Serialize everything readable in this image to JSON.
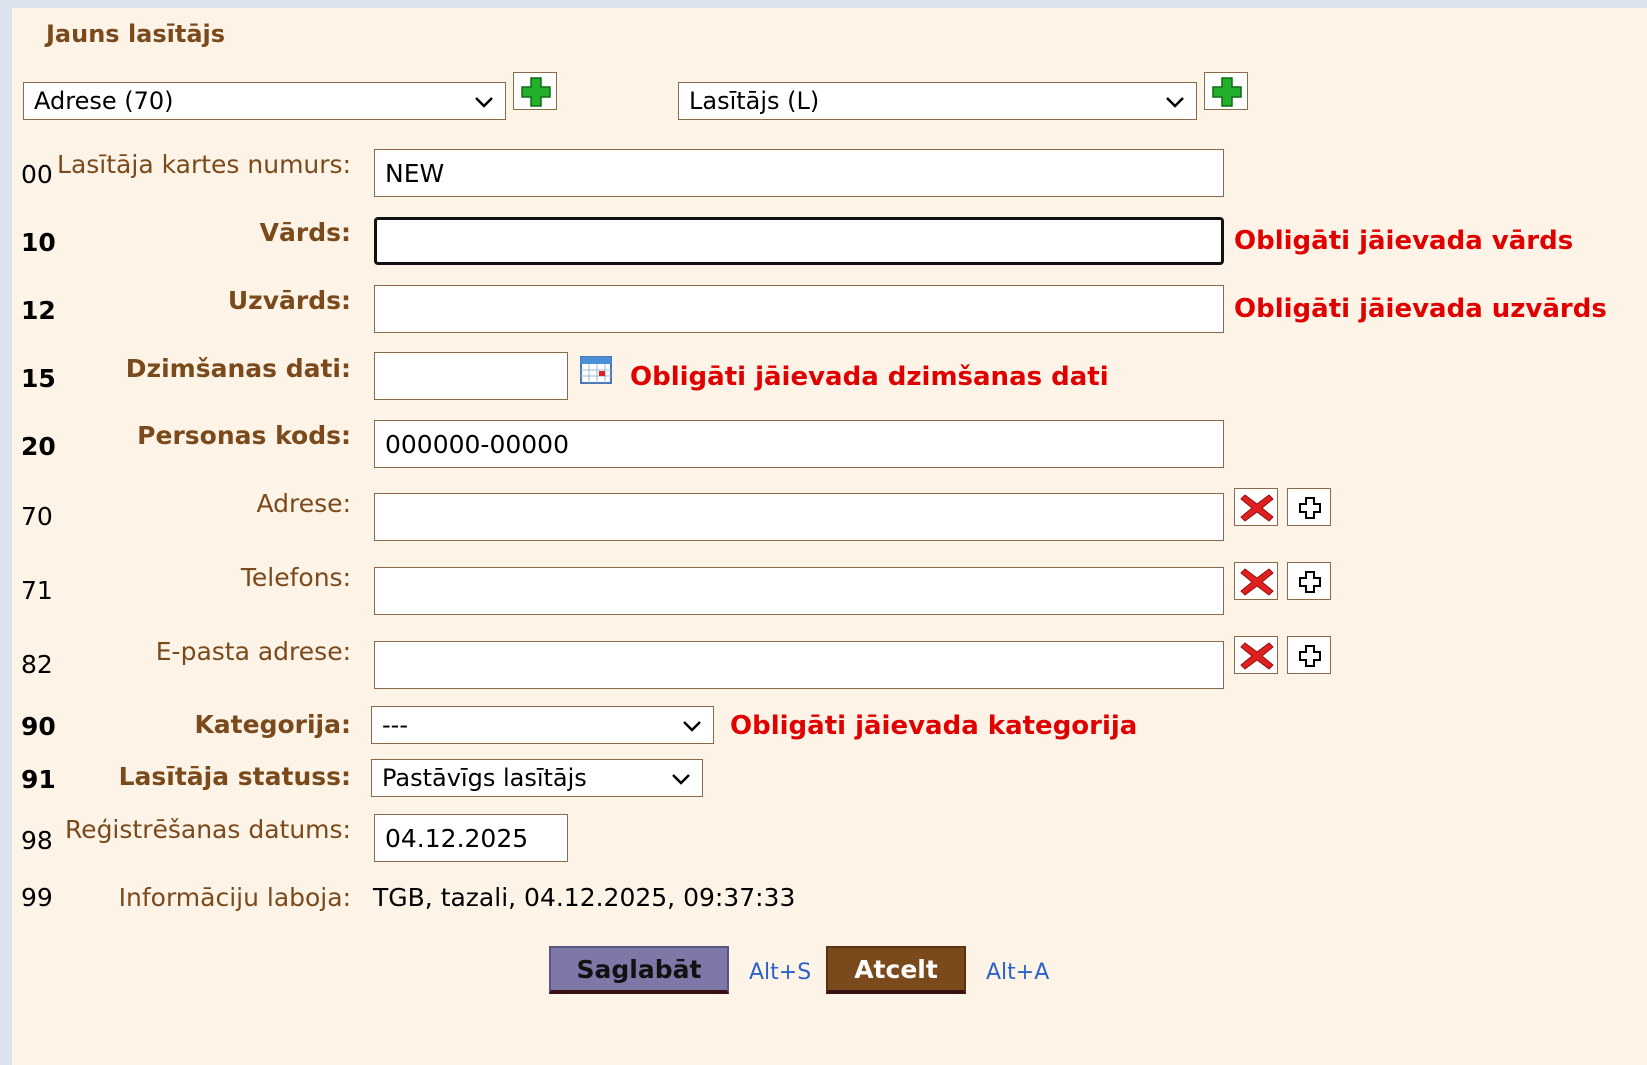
{
  "form_title": "Jauns lasītājs",
  "top_selects": {
    "address_select": "Adrese (70)",
    "reader_type_select": "Lasītājs (L)"
  },
  "fields": [
    {
      "num": "00",
      "label": "Lasītāja kartes numurs:",
      "value": "NEW"
    },
    {
      "num": "10",
      "label": "Vārds:",
      "value": "",
      "error": "Obligāti jāievada vārds"
    },
    {
      "num": "12",
      "label": "Uzvārds:",
      "value": "",
      "error": "Obligāti jāievada uzvārds"
    },
    {
      "num": "15",
      "label": "Dzimšanas dati:",
      "value": "",
      "error": "Obligāti jāievada dzimšanas dati"
    },
    {
      "num": "20",
      "label": "Personas kods:",
      "value": "000000-00000"
    },
    {
      "num": "70",
      "label": "Adrese:",
      "value": ""
    },
    {
      "num": "71",
      "label": "Telefons:",
      "value": ""
    },
    {
      "num": "82",
      "label": "E-pasta adrese:",
      "value": ""
    },
    {
      "num": "90",
      "label": "Kategorija:",
      "value": "---",
      "error": "Obligāti jāievada kategorija"
    },
    {
      "num": "91",
      "label": "Lasītāja statuss:",
      "value": "Pastāvīgs lasītājs"
    },
    {
      "num": "98",
      "label": "Reģistrēšanas datums:",
      "value": "04.12.2025"
    },
    {
      "num": "99",
      "label": "Informāciju laboja:",
      "value": "TGB, tazali, 04.12.2025, 09:37:33"
    }
  ],
  "buttons": {
    "save_label": "Saglabāt",
    "save_hotkey": "Alt+S",
    "cancel_label": "Atcelt",
    "cancel_hotkey": "Alt+A"
  },
  "icons": {
    "add": "green-plus-icon",
    "calendar": "calendar-icon",
    "delete": "red-x-icon",
    "add_row": "plus-outline-icon",
    "dropdown": "chevron-down-icon"
  },
  "colors": {
    "background": "#fdf3e6",
    "label_brown": "#7a4a1c",
    "error_red": "#e00000",
    "save_button": "#7d78a8",
    "cancel_button": "#7a4a1c",
    "hotkey_blue": "#2a63c8"
  }
}
